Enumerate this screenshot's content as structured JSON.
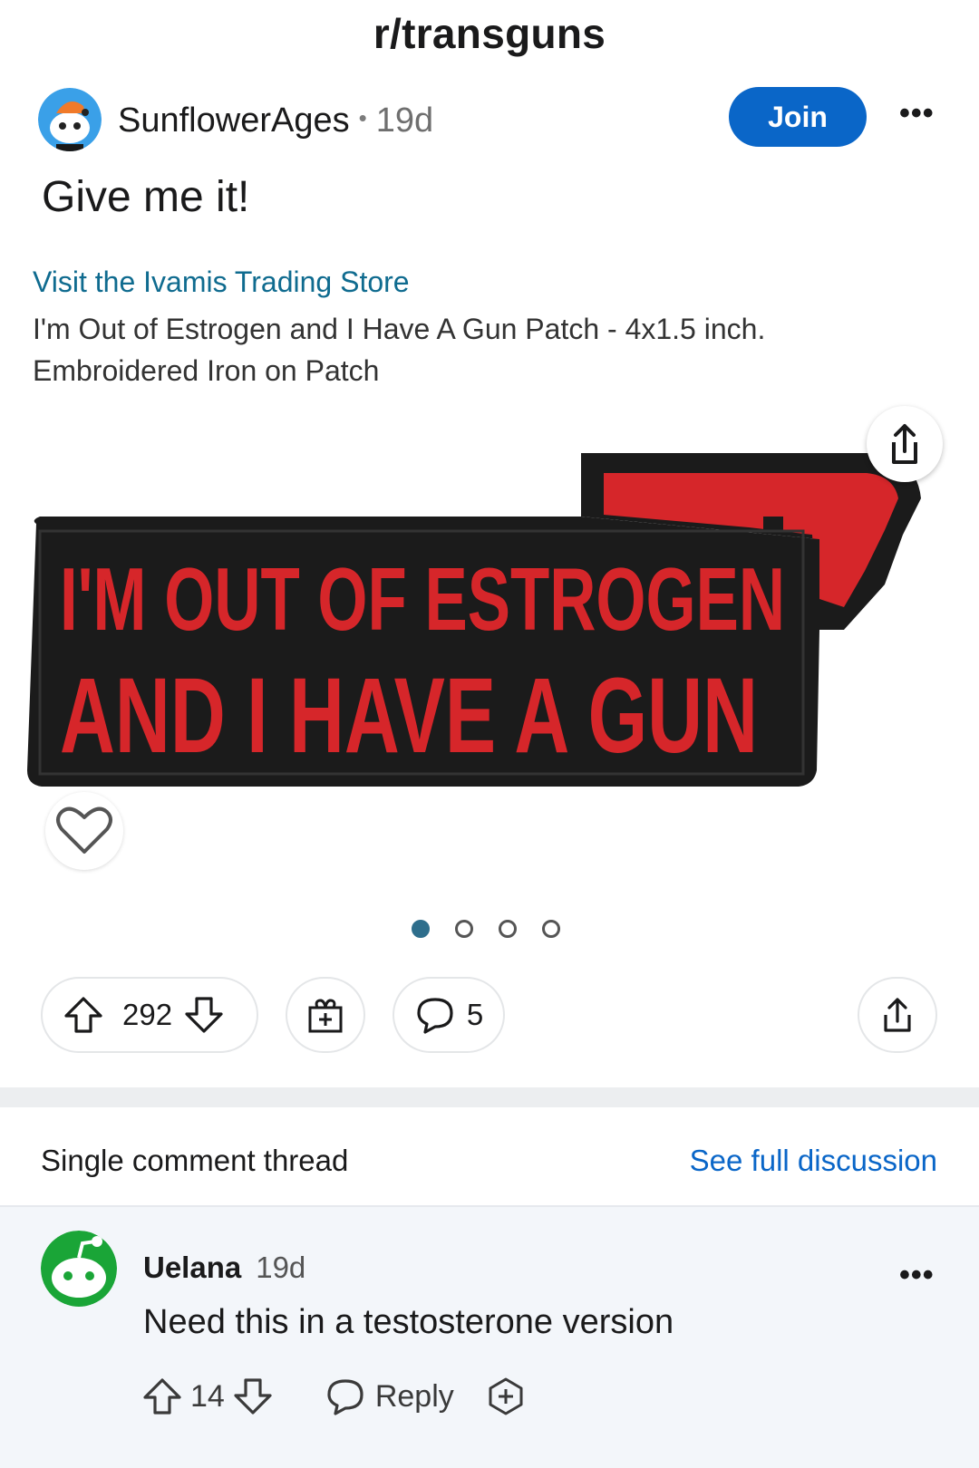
{
  "subreddit": "r/transguns",
  "post": {
    "author": "SunflowerAges",
    "age": "19d",
    "join_label": "Join",
    "title": "Give me it!",
    "store_link": "Visit the Ivamis Trading Store",
    "product_title": "I'm Out of Estrogen and I Have A Gun Patch - 4x1.5 inch. Embroidered Iron on Patch",
    "patch": {
      "line1": "I'M OUT OF ESTROGEN",
      "line2": "AND I HAVE A GUN",
      "text_color": "#d6262a",
      "patch_color": "#1b1b1b"
    },
    "carousel": {
      "count": 4,
      "active_index": 0
    },
    "upvotes": "292",
    "comments": "5"
  },
  "thread": {
    "label": "Single comment thread",
    "full_link": "See full discussion"
  },
  "comment": {
    "author": "Uelana",
    "age": "19d",
    "body": "Need this in a testosterone version",
    "votes": "14",
    "reply_label": "Reply"
  },
  "colors": {
    "accent": "#0a66c8",
    "link": "#0f6b8f",
    "avatar_blue": "#3aa0e8",
    "avatar_green": "#1aa537"
  },
  "icons": [
    "upvote-icon",
    "downvote-icon",
    "award-icon",
    "comment-icon",
    "share-icon",
    "heart-icon",
    "more-icon"
  ]
}
